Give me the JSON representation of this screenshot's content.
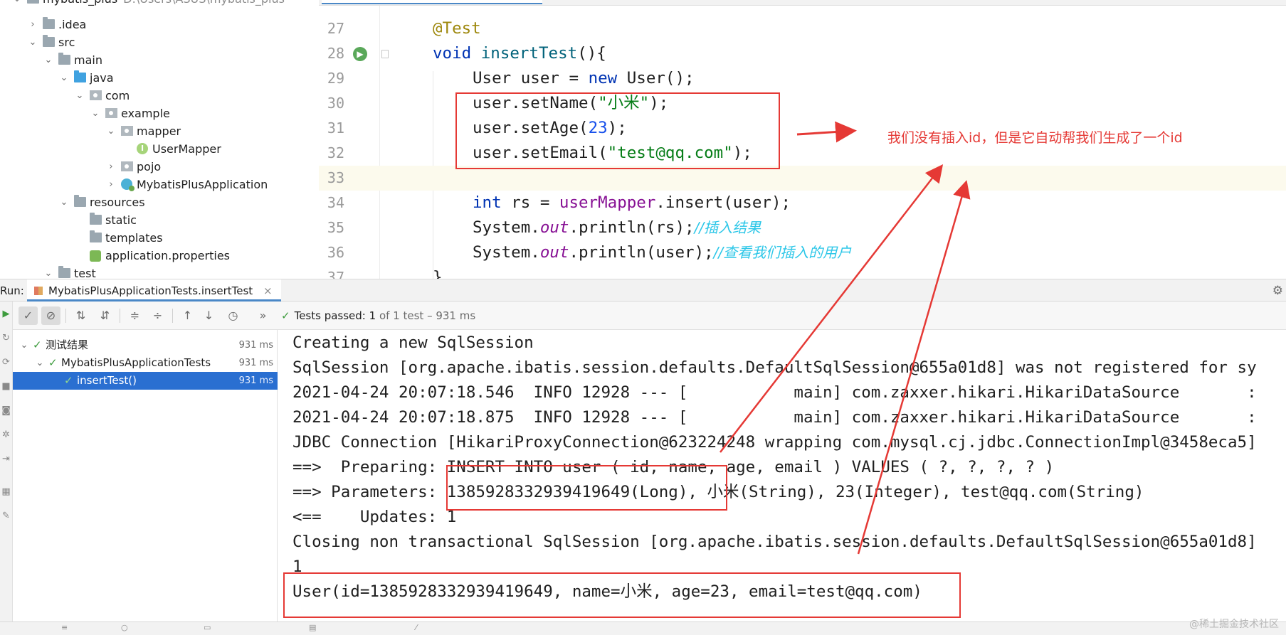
{
  "project_tree": {
    "items": [
      {
        "label": "mybatis_plus",
        "hint": "D:\\Users\\ASUS\\mybatis_plus",
        "icon": "folder-icon",
        "expanded": true
      },
      {
        "label": ".idea",
        "icon": "folder-icon",
        "expanded": false
      },
      {
        "label": "src",
        "icon": "folder-icon",
        "expanded": true
      },
      {
        "label": "main",
        "icon": "folder-icon",
        "expanded": true
      },
      {
        "label": "java",
        "icon": "source-folder-icon",
        "expanded": true
      },
      {
        "label": "com",
        "icon": "package-icon",
        "expanded": true
      },
      {
        "label": "example",
        "icon": "package-icon",
        "expanded": true
      },
      {
        "label": "mapper",
        "icon": "package-icon",
        "expanded": true
      },
      {
        "label": "UserMapper",
        "icon": "interface-icon"
      },
      {
        "label": "pojo",
        "icon": "package-icon",
        "expanded": false
      },
      {
        "label": "MybatisPlusApplication",
        "icon": "spring-class-icon",
        "expanded": false
      },
      {
        "label": "resources",
        "icon": "resources-folder-icon",
        "expanded": true
      },
      {
        "label": "static",
        "icon": "folder-icon"
      },
      {
        "label": "templates",
        "icon": "folder-icon"
      },
      {
        "label": "application.properties",
        "icon": "properties-file-icon"
      },
      {
        "label": "test",
        "icon": "folder-icon",
        "expanded": true
      }
    ]
  },
  "editor": {
    "lines": [
      {
        "n": "27",
        "tokens": [
          [
            "ann",
            "@Test"
          ]
        ]
      },
      {
        "n": "28",
        "tokens": [
          [
            "kw",
            "void "
          ],
          [
            "fn",
            "insertTest"
          ],
          [
            "",
            "(){"
          ]
        ]
      },
      {
        "n": "29",
        "tokens": [
          [
            "",
            "User user = "
          ],
          [
            "kw",
            "new "
          ],
          [
            "",
            "User();"
          ]
        ]
      },
      {
        "n": "30",
        "tokens": [
          [
            "",
            "user.setName("
          ],
          [
            "str",
            "\"小米\""
          ],
          [
            "",
            ");"
          ]
        ]
      },
      {
        "n": "31",
        "tokens": [
          [
            "",
            "user.setAge("
          ],
          [
            "num",
            "23"
          ],
          [
            "",
            ");"
          ]
        ]
      },
      {
        "n": "32",
        "tokens": [
          [
            "",
            "user.setEmail("
          ],
          [
            "str",
            "\"test@qq.com\""
          ],
          [
            "",
            ");"
          ]
        ]
      },
      {
        "n": "33",
        "tokens": []
      },
      {
        "n": "34",
        "tokens": [
          [
            "kw",
            "int "
          ],
          [
            "",
            "rs = "
          ],
          [
            "field",
            "userMapper"
          ],
          [
            "",
            ".insert(user);"
          ]
        ]
      },
      {
        "n": "35",
        "tokens": [
          [
            "",
            "System."
          ],
          [
            "stat",
            "out"
          ],
          [
            "",
            ".println(rs);"
          ],
          [
            "cmt",
            "//插入结果"
          ]
        ]
      },
      {
        "n": "36",
        "tokens": [
          [
            "",
            "System."
          ],
          [
            "stat",
            "out"
          ],
          [
            "",
            ".println(user);"
          ],
          [
            "cmt",
            "//查看我们插入的用户"
          ]
        ]
      },
      {
        "n": "37",
        "tokens": [
          [
            "",
            "}"
          ]
        ]
      }
    ]
  },
  "run_panel": {
    "label": "Run:",
    "tab_label": "MybatisPlusApplicationTests.insertTest",
    "status": {
      "prefix": "Tests passed:",
      "count": "1",
      "suffix": "of 1 test – 931 ms"
    },
    "tree": [
      {
        "label": "测试结果",
        "time": "931 ms"
      },
      {
        "label": "MybatisPlusApplicationTests",
        "time": "931 ms"
      },
      {
        "label": "insertTest()",
        "time": "931 ms",
        "selected": true
      }
    ],
    "console": [
      "Creating a new SqlSession",
      "SqlSession [org.apache.ibatis.session.defaults.DefaultSqlSession@655a01d8] was not registered for sy",
      "2021-04-24 20:07:18.546  INFO 12928 --- [           main] com.zaxxer.hikari.HikariDataSource       :",
      "2021-04-24 20:07:18.875  INFO 12928 --- [           main] com.zaxxer.hikari.HikariDataSource       :",
      "JDBC Connection [HikariProxyConnection@623224248 wrapping com.mysql.cj.jdbc.ConnectionImpl@3458eca5]",
      "==>  Preparing: INSERT INTO user ( id, name, age, email ) VALUES ( ?, ?, ?, ? )",
      "==> Parameters: 1385928332939419649(Long), 小米(String), 23(Integer), test@qq.com(String)",
      "<==    Updates: 1",
      "Closing non transactional SqlSession [org.apache.ibatis.session.defaults.DefaultSqlSession@655a01d8]",
      "1",
      "User(id=1385928332939419649, name=小米, age=23, email=test@qq.com)"
    ]
  },
  "annotation": {
    "text": "我们没有插入id，但是它自动帮我们生成了一个id",
    "color": "#e53935"
  },
  "watermark": "@稀土掘金技术社区",
  "colors": {
    "keyword": "#0033b3",
    "string": "#067d17",
    "number": "#1750eb",
    "comment": "#2dc7e8",
    "selection": "#2a6fd1",
    "success": "#3e9c3e"
  }
}
